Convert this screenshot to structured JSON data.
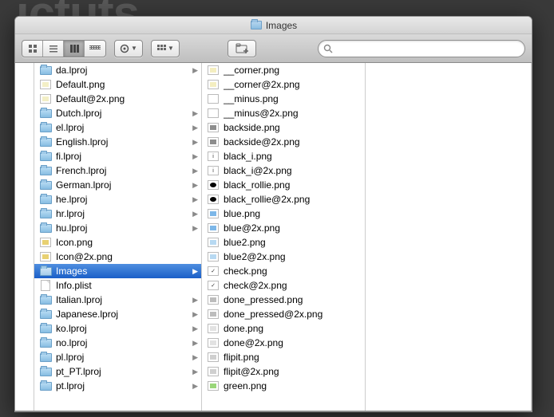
{
  "window": {
    "title": "Images"
  },
  "toolbar": {
    "views": [
      "icon",
      "list",
      "column",
      "coverflow"
    ],
    "active_view": 2,
    "search_placeholder": ""
  },
  "columns": [
    {
      "items": [
        {
          "name": "da.lproj",
          "kind": "folder",
          "arrow": true
        },
        {
          "name": "Default.png",
          "kind": "image",
          "thumb": "#f3efc6"
        },
        {
          "name": "Default@2x.png",
          "kind": "image",
          "thumb": "#f3efc6"
        },
        {
          "name": "Dutch.lproj",
          "kind": "folder",
          "arrow": true
        },
        {
          "name": "el.lproj",
          "kind": "folder",
          "arrow": true
        },
        {
          "name": "English.lproj",
          "kind": "folder",
          "arrow": true
        },
        {
          "name": "fi.lproj",
          "kind": "folder",
          "arrow": true
        },
        {
          "name": "French.lproj",
          "kind": "folder",
          "arrow": true
        },
        {
          "name": "German.lproj",
          "kind": "folder",
          "arrow": true
        },
        {
          "name": "he.lproj",
          "kind": "folder",
          "arrow": true
        },
        {
          "name": "hr.lproj",
          "kind": "folder",
          "arrow": true
        },
        {
          "name": "hu.lproj",
          "kind": "folder",
          "arrow": true
        },
        {
          "name": "Icon.png",
          "kind": "image",
          "thumb": "#e8d172"
        },
        {
          "name": "Icon@2x.png",
          "kind": "image",
          "thumb": "#e8d172"
        },
        {
          "name": "Images",
          "kind": "folder",
          "arrow": true,
          "selected": true
        },
        {
          "name": "Info.plist",
          "kind": "doc"
        },
        {
          "name": "Italian.lproj",
          "kind": "folder",
          "arrow": true
        },
        {
          "name": "Japanese.lproj",
          "kind": "folder",
          "arrow": true
        },
        {
          "name": "ko.lproj",
          "kind": "folder",
          "arrow": true
        },
        {
          "name": "no.lproj",
          "kind": "folder",
          "arrow": true
        },
        {
          "name": "pl.lproj",
          "kind": "folder",
          "arrow": true
        },
        {
          "name": "pt_PT.lproj",
          "kind": "folder",
          "arrow": true
        },
        {
          "name": "pt.lproj",
          "kind": "folder",
          "arrow": true
        }
      ]
    },
    {
      "items": [
        {
          "name": "__corner.png",
          "kind": "image",
          "thumb": "#f4eec0"
        },
        {
          "name": "__corner@2x.png",
          "kind": "image",
          "thumb": "#f4eec0"
        },
        {
          "name": "__minus.png",
          "kind": "image",
          "thumb": "#ffffff"
        },
        {
          "name": "__minus@2x.png",
          "kind": "image",
          "thumb": "#ffffff"
        },
        {
          "name": "backside.png",
          "kind": "image",
          "thumb": "#8d8d8d"
        },
        {
          "name": "backside@2x.png",
          "kind": "image",
          "thumb": "#8d8d8d"
        },
        {
          "name": "black_i.png",
          "kind": "image",
          "thumb": "#ffffff",
          "glyph": "i"
        },
        {
          "name": "black_i@2x.png",
          "kind": "image",
          "thumb": "#ffffff",
          "glyph": "i"
        },
        {
          "name": "black_rollie.png",
          "kind": "image",
          "thumb": "#000000",
          "round": true
        },
        {
          "name": "black_rollie@2x.png",
          "kind": "image",
          "thumb": "#000000",
          "round": true
        },
        {
          "name": "blue.png",
          "kind": "image",
          "thumb": "#7db7e8"
        },
        {
          "name": "blue@2x.png",
          "kind": "image",
          "thumb": "#7db7e8"
        },
        {
          "name": "blue2.png",
          "kind": "image",
          "thumb": "#b7d9f2"
        },
        {
          "name": "blue2@2x.png",
          "kind": "image",
          "thumb": "#b7d9f2"
        },
        {
          "name": "check.png",
          "kind": "image",
          "thumb": "#ffffff",
          "glyph": "✓"
        },
        {
          "name": "check@2x.png",
          "kind": "image",
          "thumb": "#ffffff",
          "glyph": "✓"
        },
        {
          "name": "done_pressed.png",
          "kind": "image",
          "thumb": "#bcbcbc"
        },
        {
          "name": "done_pressed@2x.png",
          "kind": "image",
          "thumb": "#bcbcbc"
        },
        {
          "name": "done.png",
          "kind": "image",
          "thumb": "#e2e2e2"
        },
        {
          "name": "done@2x.png",
          "kind": "image",
          "thumb": "#e2e2e2"
        },
        {
          "name": "flipit.png",
          "kind": "image",
          "thumb": "#cfcfcf"
        },
        {
          "name": "flipit@2x.png",
          "kind": "image",
          "thumb": "#cfcfcf"
        },
        {
          "name": "green.png",
          "kind": "image",
          "thumb": "#9ad67a"
        }
      ]
    }
  ]
}
